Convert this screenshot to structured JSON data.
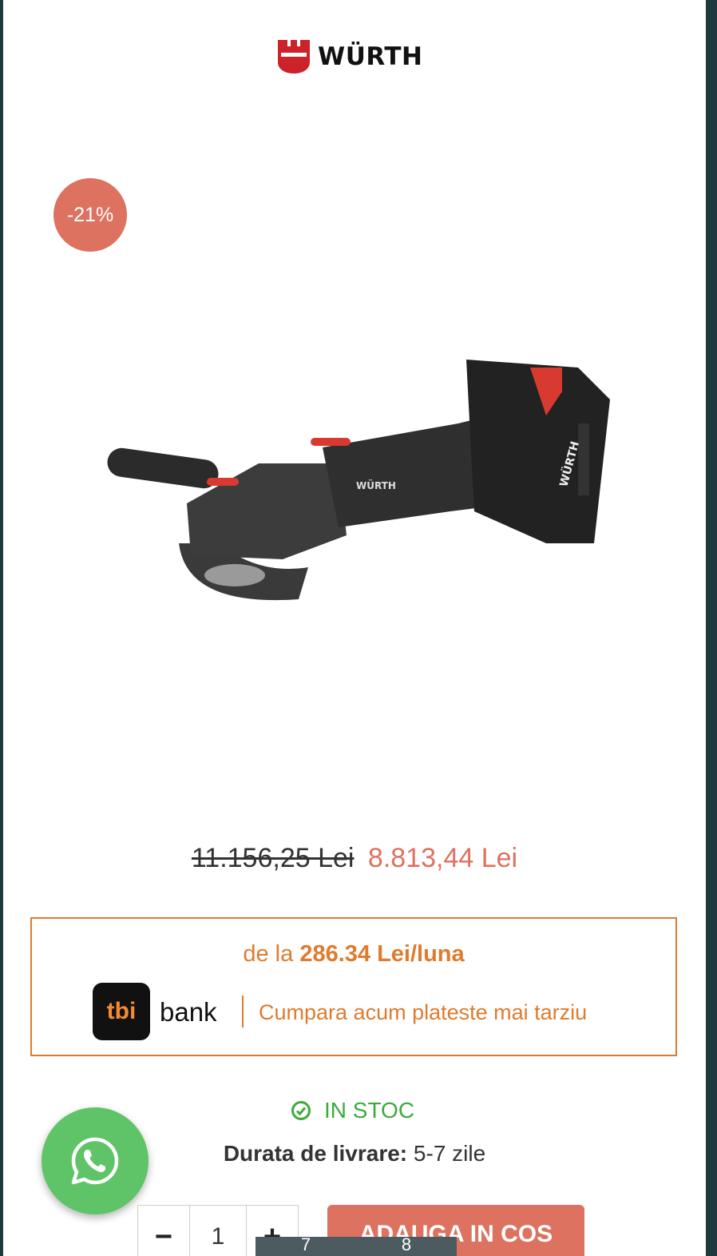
{
  "header": {
    "brand": "WÜRTH"
  },
  "product": {
    "discount_badge": "-21%"
  },
  "price": {
    "old": "11.156,25 Lei",
    "new": "8.813,44 Lei"
  },
  "financing": {
    "prefix": "de la",
    "amount": "286.34 Lei/luna",
    "bank_logo": "tbi",
    "bank_name": "bank",
    "slogan": "Cumpara acum plateste mai tarziu"
  },
  "stock": {
    "status": "IN STOC"
  },
  "delivery": {
    "label": "Durata de livrare:",
    "value": "5-7 zile"
  },
  "quantity": {
    "minus": "−",
    "value": "1",
    "plus": "+"
  },
  "cart": {
    "button_label": "ADAUGA IN COS"
  },
  "pager": {
    "items": [
      "7",
      "8"
    ]
  },
  "colors": {
    "accent": "#dd7260",
    "financing": "#e07b2e",
    "stock": "#3cab3c",
    "whatsapp": "#5fc468"
  },
  "icons": [
    "wurth-logo-icon",
    "check-circle-icon",
    "whatsapp-icon"
  ]
}
